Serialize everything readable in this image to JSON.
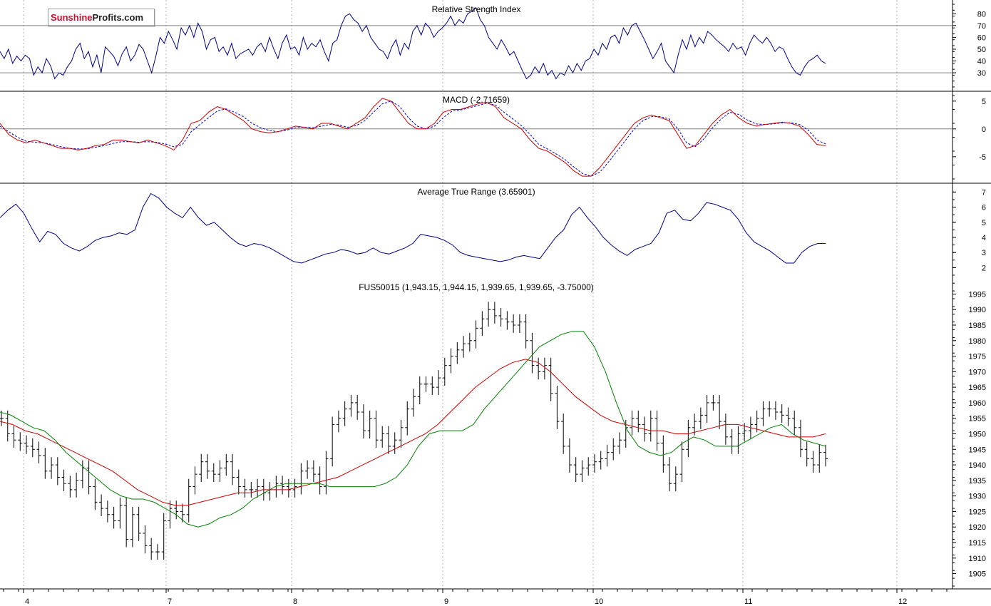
{
  "logo": {
    "part1": "Sunshine",
    "part2": "Profits.com"
  },
  "chart_data": [
    {
      "type": "line",
      "title": "Relative Strength Index",
      "ylim": [
        18,
        88
      ],
      "yticks": [
        30,
        40,
        50,
        60,
        70,
        80
      ],
      "reference_lines": [
        30,
        70
      ],
      "series": [
        {
          "color": "#000080",
          "values": [
            48,
            42,
            50,
            38,
            44,
            40,
            45,
            42,
            28,
            35,
            30,
            42,
            36,
            25,
            30,
            28,
            35,
            40,
            50,
            55,
            42,
            48,
            35,
            45,
            30,
            52,
            48,
            44,
            36,
            46,
            52,
            40,
            45,
            54,
            50,
            40,
            30,
            44,
            60,
            55,
            65,
            58,
            50,
            68,
            62,
            70,
            60,
            72,
            65,
            50,
            58,
            60,
            48,
            52,
            45,
            55,
            42,
            46,
            48,
            50,
            45,
            52,
            55,
            48,
            60,
            50,
            42,
            55,
            62,
            50,
            52,
            45,
            60,
            50,
            55,
            52,
            58,
            48,
            40,
            55,
            58,
            70,
            78,
            80,
            75,
            72,
            65,
            70,
            60,
            55,
            50,
            48,
            42,
            52,
            58,
            45,
            55,
            50,
            65,
            70,
            62,
            72,
            68,
            60,
            65,
            68,
            72,
            78,
            70,
            75,
            72,
            80,
            82,
            85,
            75,
            70,
            60,
            55,
            50,
            58,
            52,
            45,
            48,
            40,
            32,
            25,
            28,
            35,
            30,
            38,
            28,
            32,
            25,
            30,
            28,
            36,
            30,
            38,
            32,
            40,
            42,
            50,
            45,
            55,
            50,
            60,
            62,
            55,
            68,
            62,
            70,
            72,
            65,
            58,
            50,
            42,
            48,
            55,
            40,
            35,
            30,
            45,
            58,
            50,
            62,
            52,
            60,
            55,
            65,
            62,
            58,
            55,
            52,
            48,
            55,
            50,
            52,
            45,
            55,
            62,
            58,
            55,
            60,
            55,
            48,
            52,
            50,
            42,
            35,
            30,
            28,
            35,
            40,
            42,
            45,
            40,
            38
          ]
        }
      ]
    },
    {
      "type": "line",
      "title": "MACD (-2.71659)",
      "ylim": [
        -9,
        6
      ],
      "yticks": [
        5,
        0,
        -5
      ],
      "reference_lines": [
        0
      ],
      "series": [
        {
          "name": "",
          "color": "#cc0000",
          "values": [
            1,
            -1,
            -2,
            -2.5,
            -2,
            -2.5,
            -3,
            -3.5,
            -3.5,
            -3.8,
            -3.5,
            -3,
            -2.8,
            -2,
            -2,
            -2.3,
            -2.5,
            -2,
            -2.5,
            -3,
            -3.8,
            -2,
            1,
            1.5,
            3,
            4,
            3.5,
            2.5,
            1.5,
            0,
            -0.5,
            -0.7,
            -0.5,
            0,
            0.5,
            0.3,
            0,
            1,
            1,
            0.5,
            0,
            1,
            2,
            4,
            5.5,
            5,
            3,
            1,
            0,
            0,
            1,
            3,
            3.5,
            3.5,
            4,
            4.5,
            4.8,
            4,
            2,
            1,
            0,
            -2,
            -3.5,
            -4,
            -5,
            -6,
            -7.5,
            -8.5,
            -8.5,
            -7,
            -5,
            -3,
            -1,
            1,
            2,
            2.5,
            2,
            1.5,
            -1,
            -3.5,
            -3,
            -1,
            1,
            2.5,
            3.5,
            2,
            1,
            0.5,
            0.8,
            1,
            1.2,
            1,
            0.5,
            -1,
            -2.8,
            -3
          ]
        },
        {
          "name": "",
          "color": "#0000cc",
          "dashed": true,
          "values": [
            0.5,
            -0.5,
            -1.5,
            -2.2,
            -2.4,
            -2.5,
            -2.8,
            -3.2,
            -3.5,
            -3.6,
            -3.6,
            -3.3,
            -3,
            -2.6,
            -2.3,
            -2.3,
            -2.4,
            -2.3,
            -2.4,
            -2.7,
            -3.2,
            -2.8,
            -0.5,
            0.8,
            2,
            3.2,
            3.6,
            3,
            2.2,
            1,
            0.2,
            -0.3,
            -0.5,
            -0.2,
            0.2,
            0.3,
            0.2,
            0.5,
            0.8,
            0.7,
            0.3,
            0.6,
            1.5,
            3,
            4.5,
            5,
            4,
            2,
            0.5,
            0,
            0.5,
            2,
            3.2,
            3.4,
            3.8,
            4.2,
            4.6,
            4.3,
            3,
            1.8,
            0.6,
            -1,
            -2.8,
            -3.6,
            -4.5,
            -5.5,
            -6.8,
            -8,
            -8.5,
            -7.8,
            -6,
            -4,
            -2,
            0,
            1.5,
            2.2,
            2.2,
            1.8,
            0,
            -2.5,
            -3.2,
            -1.8,
            0.2,
            1.8,
            3,
            2.6,
            1.6,
            0.9,
            0.8,
            0.9,
            1.1,
            1.1,
            0.8,
            -0.2,
            -2,
            -2.7
          ]
        }
      ]
    },
    {
      "type": "line",
      "title": "Average True Range (3.65901)",
      "ylim": [
        1.5,
        7.3
      ],
      "yticks": [
        2,
        3,
        4,
        5,
        6,
        7
      ],
      "series": [
        {
          "color": "#000080",
          "values": [
            5.3,
            5.8,
            6.2,
            5.6,
            4.6,
            3.7,
            4.4,
            4.2,
            3.6,
            3.3,
            3.1,
            3.4,
            3.8,
            4.0,
            4.1,
            4.3,
            4.2,
            4.5,
            6.0,
            6.9,
            6.6,
            6.0,
            5.6,
            5.3,
            6.0,
            5.3,
            4.8,
            5.0,
            4.5,
            4.0,
            3.6,
            3.4,
            3.6,
            3.5,
            3.3,
            3.0,
            2.7,
            2.4,
            2.3,
            2.5,
            2.7,
            2.9,
            3.0,
            3.2,
            3.1,
            2.9,
            3.0,
            3.3,
            3.0,
            2.9,
            3.1,
            3.3,
            3.6,
            4.2,
            4.1,
            4.0,
            3.8,
            3.5,
            3.0,
            2.8,
            2.7,
            2.6,
            2.5,
            2.4,
            2.5,
            2.7,
            2.8,
            2.7,
            2.6,
            3.3,
            4.0,
            4.5,
            5.5,
            6.0,
            5.3,
            4.7,
            4.0,
            3.5,
            3.1,
            2.8,
            3.2,
            3.4,
            3.6,
            4.3,
            5.6,
            5.8,
            5.2,
            5.1,
            5.6,
            6.3,
            6.2,
            6.0,
            5.8,
            5.2,
            4.3,
            3.7,
            3.4,
            3.1,
            2.7,
            2.3,
            2.3,
            3.0,
            3.4,
            3.6,
            3.6
          ]
        }
      ]
    },
    {
      "type": "bar",
      "title": "FUS50015 (1,943.15, 1,944.15, 1,939.65, 1,939.65, -3.75000)",
      "ylim": [
        1901,
        1999
      ],
      "yticks": [
        1905,
        1910,
        1915,
        1920,
        1925,
        1930,
        1935,
        1940,
        1945,
        1950,
        1955,
        1960,
        1965,
        1970,
        1975,
        1980,
        1985,
        1990,
        1995
      ],
      "xticks": [
        "4",
        "7",
        "8",
        "9",
        "10",
        "11",
        "12"
      ],
      "series": [
        {
          "name": "",
          "color": "#000000",
          "values": [
            1955,
            1950,
            1948,
            1947,
            1946,
            1945,
            1943,
            1938,
            1940,
            1936,
            1934,
            1932,
            1935,
            1939,
            1933,
            1928,
            1926,
            1924,
            1922,
            1927,
            1916,
            1924,
            1918,
            1914,
            1912,
            1912,
            1922,
            1926,
            1925,
            1924,
            1933,
            1937,
            1941,
            1938,
            1937,
            1939,
            1941,
            1936,
            1933,
            1932,
            1932,
            1933,
            1931,
            1932,
            1934,
            1933,
            1932,
            1933,
            1938,
            1939,
            1937,
            1933,
            1942,
            1953,
            1955,
            1958,
            1960,
            1957,
            1951,
            1955,
            1948,
            1950,
            1946,
            1948,
            1952,
            1958,
            1962,
            1966,
            1966,
            1965,
            1968,
            1972,
            1975,
            1977,
            1979,
            1980,
            1984,
            1987,
            1990,
            1988,
            1987,
            1986,
            1985,
            1986,
            1980,
            1972,
            1970,
            1972,
            1963,
            1954,
            1946,
            1940,
            1937,
            1939,
            1940,
            1941,
            1942,
            1944,
            1946,
            1948,
            1952,
            1955,
            1953,
            1950,
            1955,
            1947,
            1940,
            1934,
            1937,
            1945,
            1952,
            1954,
            1956,
            1960,
            1960,
            1954,
            1949,
            1946,
            1950,
            1951,
            1953,
            1955,
            1958,
            1958,
            1957,
            1956,
            1955,
            1952,
            1945,
            1942,
            1940,
            1944,
            1942
          ]
        },
        {
          "name": "",
          "color": "#008000",
          "values": [
            1957,
            1956,
            1954,
            1952,
            1951,
            1948,
            1944,
            1941,
            1938,
            1935,
            1932,
            1930,
            1929,
            1929,
            1928,
            1926,
            1924,
            1921,
            1920,
            1921,
            1923,
            1924,
            1926,
            1929,
            1931,
            1933,
            1934,
            1934,
            1934,
            1934,
            1933,
            1933,
            1933,
            1933,
            1933,
            1934,
            1936,
            1940,
            1946,
            1950,
            1951,
            1951,
            1951,
            1953,
            1958,
            1962,
            1966,
            1970,
            1974,
            1978,
            1980,
            1982,
            1983,
            1983,
            1978,
            1970,
            1960,
            1951,
            1946,
            1944,
            1943,
            1944,
            1947,
            1949,
            1948,
            1946,
            1946,
            1946,
            1948,
            1950,
            1952,
            1953,
            1950,
            1948,
            1947,
            1946
          ]
        },
        {
          "name": "",
          "color": "#cc0000",
          "values": [
            1954,
            1953,
            1951,
            1950,
            1948,
            1946,
            1944,
            1942,
            1940,
            1938,
            1935,
            1932,
            1930,
            1928,
            1927,
            1927,
            1928,
            1929,
            1930,
            1931,
            1931,
            1932,
            1932,
            1932,
            1933,
            1934,
            1935,
            1936,
            1938,
            1940,
            1942,
            1944,
            1946,
            1948,
            1950,
            1953,
            1957,
            1961,
            1965,
            1968,
            1971,
            1973,
            1974,
            1973,
            1970,
            1966,
            1962,
            1959,
            1956,
            1954,
            1953,
            1952,
            1951,
            1951,
            1950,
            1950,
            1951,
            1952,
            1953,
            1953,
            1952,
            1951,
            1950,
            1949,
            1949,
            1949,
            1950
          ]
        }
      ]
    }
  ]
}
